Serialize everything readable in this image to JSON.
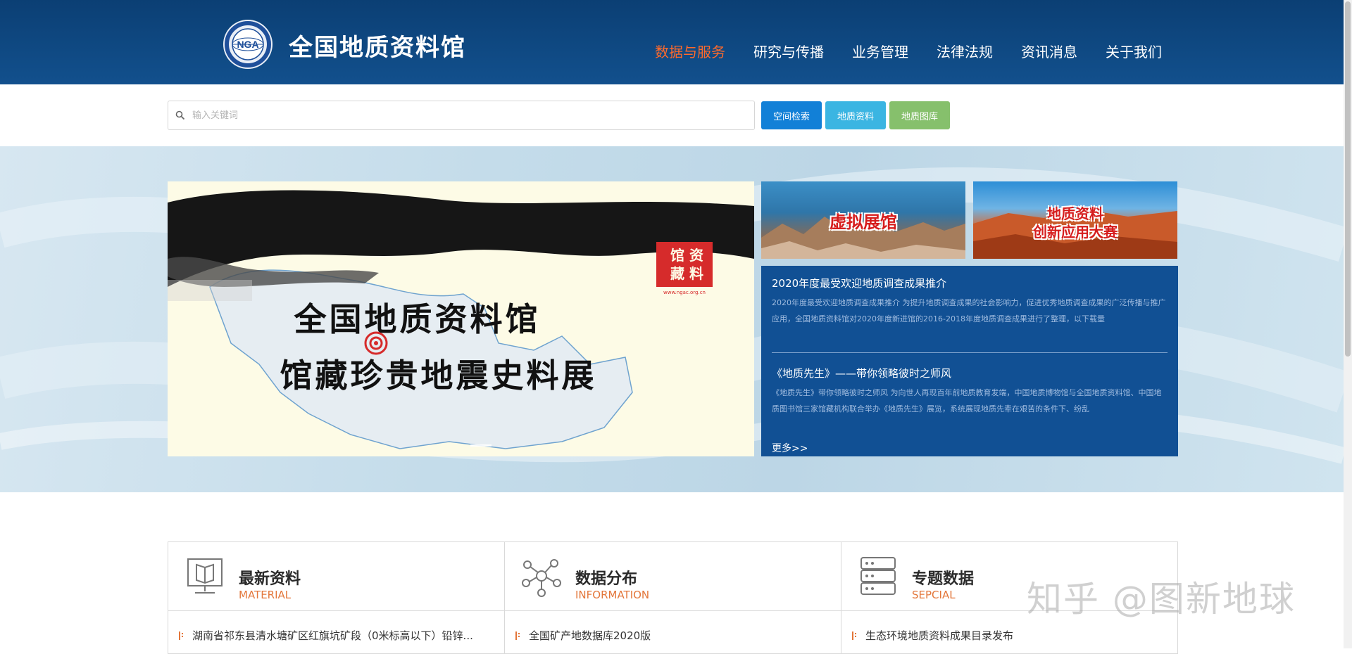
{
  "header": {
    "logo_text": "NGA",
    "site_title": "全国地质资料馆",
    "nav": [
      {
        "label": "数据与服务",
        "active": true
      },
      {
        "label": "研究与传播",
        "active": false
      },
      {
        "label": "业务管理",
        "active": false
      },
      {
        "label": "法律法规",
        "active": false
      },
      {
        "label": "资讯消息",
        "active": false
      },
      {
        "label": "关于我们",
        "active": false
      }
    ],
    "active_color": "#ff6a2b"
  },
  "search": {
    "placeholder": "输入关键词",
    "buttons": [
      {
        "label": "空间检索",
        "color": "#1280d7"
      },
      {
        "label": "地质资料",
        "color": "#3bb5e2"
      },
      {
        "label": "地质图库",
        "color": "#86c06c"
      }
    ]
  },
  "banner": {
    "stamp_text": "www.ngac.org.cn",
    "line1": "全国地质资料馆",
    "line2": "馆藏珍贵地震史料展",
    "promo1": "虚拟展馆",
    "promo2_line1": "地质资料",
    "promo2_line2": "创新应用大赛"
  },
  "news": {
    "items": [
      {
        "title": "2020年度最受欢迎地质调查成果推介",
        "summary": "2020年度最受欢迎地质调查成果推介 为提升地质调查成果的社会影响力，促进优秀地质调查成果的广泛传播与推广应用，全国地质资料馆对2020年度新进馆的2016-2018年度地质调查成果进行了整理，以下载量"
      },
      {
        "title": "《地质先生》——带你领略彼时之师风",
        "summary": "《地质先生》带你领略彼时之师风 为向世人再现百年前地质教育发端，中国地质博物馆与全国地质资料馆、中国地质图书馆三家馆藏机构联合举办《地质先生》展览，系统展现地质先辈在艰苦的条件下、纷乱"
      }
    ],
    "more": "更多>>"
  },
  "cards": [
    {
      "title": "最新资料",
      "subtitle": "MATERIAL",
      "icon": "book-board-icon",
      "item": "湖南省祁东县清水塘矿区红旗坑矿段（0米标高以下）铅锌..."
    },
    {
      "title": "数据分布",
      "subtitle": "INFORMATION",
      "icon": "network-nodes-icon",
      "item": "全国矿产地数据库2020版"
    },
    {
      "title": "专题数据",
      "subtitle": "SEPCIAL",
      "icon": "server-icon",
      "item": "生态环境地质资料成果目录发布"
    }
  ],
  "watermark": "知乎 @图新地球"
}
